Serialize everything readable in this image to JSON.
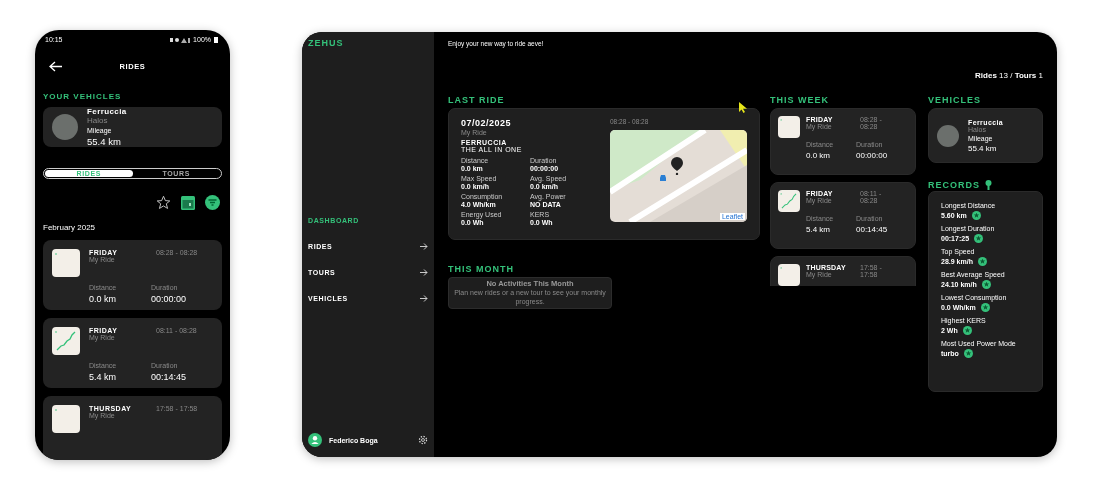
{
  "phone": {
    "status_bar": {
      "time": "10:15",
      "battery": "100%"
    },
    "title": "RIDES",
    "vehicles_heading": "YOUR VEHICLES",
    "vehicle": {
      "name": "Ferruccia",
      "model": "Halos",
      "mileage_label": "Mileage",
      "mileage": "55.4 km"
    },
    "tabs": [
      {
        "label": "RIDES",
        "selected": true
      },
      {
        "label": "TOURS",
        "selected": false
      }
    ],
    "month": "February 2025",
    "rides": [
      {
        "day": "FRIDAY",
        "subtitle": "My Ride",
        "time": "08:28 - 08:28",
        "distance_label": "Distance",
        "distance": "0.0 km",
        "duration_label": "Duration",
        "duration": "00:00:00",
        "has_route": false
      },
      {
        "day": "FRIDAY",
        "subtitle": "My Ride",
        "time": "08:11 - 08:28",
        "distance_label": "Distance",
        "distance": "5.4 km",
        "duration_label": "Duration",
        "duration": "00:14:45",
        "has_route": true
      },
      {
        "day": "THURSDAY",
        "subtitle": "My Ride",
        "time": "17:58 - 17:58",
        "has_route": false
      }
    ]
  },
  "desktop": {
    "logo": "ZEHUS",
    "sidebar": {
      "items": [
        {
          "label": "DASHBOARD",
          "selected": true
        },
        {
          "label": "RIDES",
          "selected": false
        },
        {
          "label": "TOURS",
          "selected": false
        },
        {
          "label": "VEHICLES",
          "selected": false
        }
      ],
      "user": "Federico Boga"
    },
    "tagline": "Enjoy your new way to ride aeve!",
    "counts": "**Rides** 13 / **Tours** 1",
    "last_ride": {
      "heading": "LAST RIDE",
      "date": "07/02/2025",
      "subtitle": "My Ride",
      "vehicle": "FERRUCCIA",
      "model": "THE ALL IN ONE",
      "time": "08:28 - 08:28",
      "map_attribution": "Leaflet",
      "stats": [
        {
          "label": "Distance",
          "value": "0.0 km"
        },
        {
          "label": "Duration",
          "value": "00:00:00"
        },
        {
          "label": "Max Speed",
          "value": "0.0 km/h"
        },
        {
          "label": "Avg. Speed",
          "value": "0.0 km/h"
        },
        {
          "label": "Consumption",
          "value": "4.0 Wh/km"
        },
        {
          "label": "Avg. Power",
          "value": "NO DATA"
        },
        {
          "label": "Energy Used",
          "value": "0.0 Wh"
        },
        {
          "label": "KERS",
          "value": "0.0 Wh"
        }
      ]
    },
    "this_month": {
      "heading": "THIS MONTH",
      "title": "No Activities This Month",
      "message": "Plan new rides or a new tour to see your monthly progress."
    },
    "this_week": {
      "heading": "THIS WEEK",
      "rides": [
        {
          "day": "FRIDAY",
          "subtitle": "My Ride",
          "time": "08:28 - 08:28",
          "distance_label": "Distance",
          "distance": "0.0 km",
          "duration_label": "Duration",
          "duration": "00:00:00",
          "has_route": false
        },
        {
          "day": "FRIDAY",
          "subtitle": "My Ride",
          "time": "08:11 - 08:28",
          "distance_label": "Distance",
          "distance": "5.4 km",
          "duration_label": "Duration",
          "duration": "00:14:45",
          "has_route": true
        },
        {
          "day": "THURSDAY",
          "subtitle": "My Ride",
          "time": "17:58 - 17:58",
          "has_route": false
        }
      ]
    },
    "vehicles": {
      "heading": "VEHICLES",
      "vehicle": {
        "name": "Ferruccia",
        "model": "Halos",
        "mileage_label": "Mileage",
        "mileage": "55.4 km"
      }
    },
    "records": {
      "heading": "RECORDS",
      "items": [
        {
          "label": "Longest Distance",
          "value": "5.60 km"
        },
        {
          "label": "Longest Duration",
          "value": "00:17:25"
        },
        {
          "label": "Top Speed",
          "value": "28.9 km/h"
        },
        {
          "label": "Best Average Speed",
          "value": "24.10 km/h"
        },
        {
          "label": "Lowest Consumption",
          "value": "0.0 Wh/km"
        },
        {
          "label": "Highest KERS",
          "value": "2 Wh"
        },
        {
          "label": "Most Used Power Mode",
          "value": "turbo"
        }
      ]
    }
  }
}
